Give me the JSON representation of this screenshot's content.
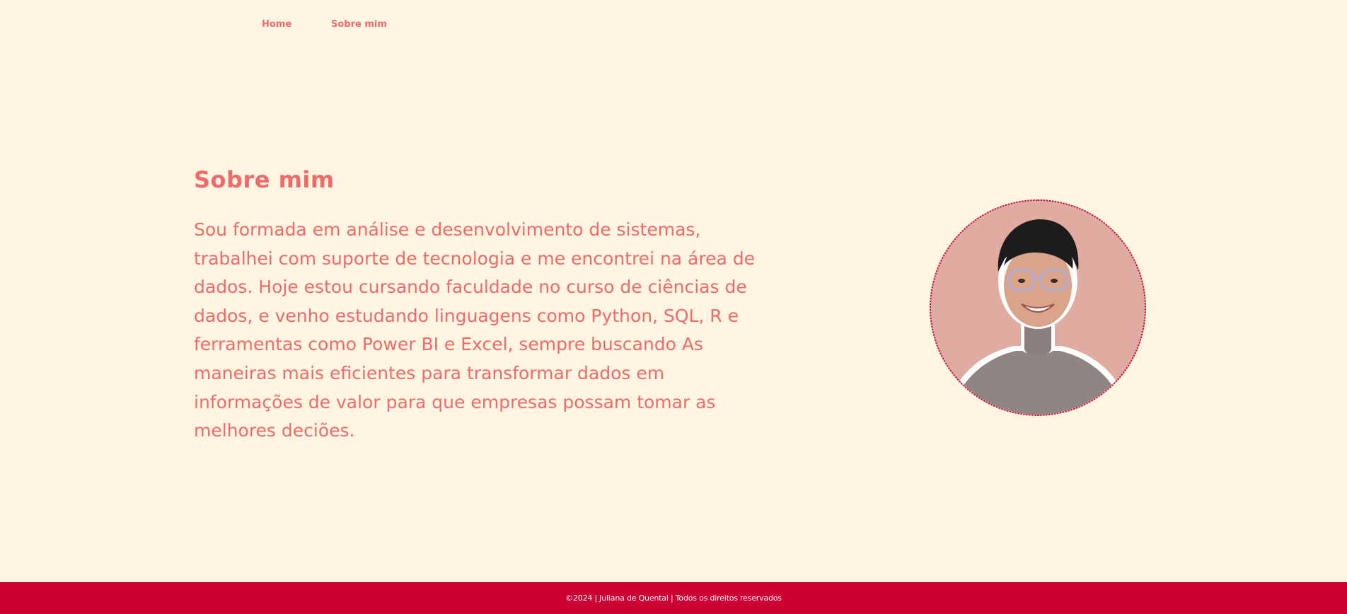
{
  "nav": {
    "items": [
      {
        "label": "Home"
      },
      {
        "label": "Sobre mim"
      }
    ]
  },
  "about": {
    "title": "Sobre mim",
    "text": "Sou formada em análise e desenvolvimento de sistemas, trabalhei com suporte de tecnologia e me encontrei na área de dados. Hoje estou cursando faculdade no curso de ciências de dados, e venho estudando linguagens como Python, SQL, R e ferramentas como Power BI e Excel, sempre buscando As maneiras mais eficientes para transformar dados em informações de valor para que empresas possam tomar as melhores deciões."
  },
  "profile": {
    "alt": "profile-photo",
    "icon": "person-photo"
  },
  "footer": {
    "text": "©2024 | Juliana de Quental | Todos os direitos reservados"
  },
  "colors": {
    "background": "#fff5e1",
    "accent": "#f16a6a",
    "footer": "#cc0033",
    "photo_bg": "#e0aca1"
  }
}
